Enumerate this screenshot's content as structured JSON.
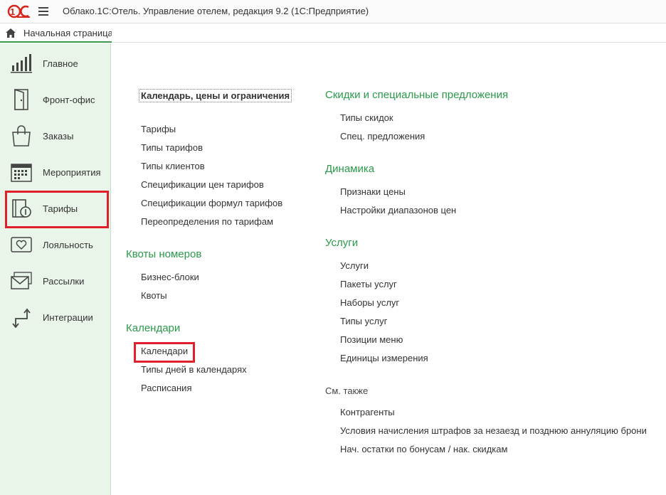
{
  "titlebar": {
    "logo_text": "1С",
    "app_title": "Облако.1С:Отель. Управление отелем, редакция 9.2  (1С:Предприятие)"
  },
  "tabs": {
    "home_label": "Начальная страница"
  },
  "sidebar": {
    "items": [
      {
        "label": "Главное",
        "icon": "bar-chart-icon"
      },
      {
        "label": "Фронт-офис",
        "icon": "door-icon"
      },
      {
        "label": "Заказы",
        "icon": "shopping-bag-icon"
      },
      {
        "label": "Мероприятия",
        "icon": "calendar-icon"
      },
      {
        "label": "Тарифы",
        "icon": "tariff-book-icon"
      },
      {
        "label": "Лояльность",
        "icon": "heart-card-icon"
      },
      {
        "label": "Рассылки",
        "icon": "envelope-icon"
      },
      {
        "label": "Интеграции",
        "icon": "arrows-icon"
      }
    ],
    "active_index": 4
  },
  "main": {
    "left": {
      "section1_head": "Календарь, цены и ограничения",
      "section1_links": [
        "Тарифы",
        "Типы тарифов",
        "Типы клиентов",
        "Спецификации цен тарифов",
        "Спецификации формул тарифов",
        "Переопределения по тарифам"
      ],
      "section2_head": "Квоты номеров",
      "section2_links": [
        "Бизнес-блоки",
        "Квоты"
      ],
      "section3_head": "Календари",
      "section3_links": [
        "Календари",
        "Типы дней в календарях",
        "Расписания"
      ]
    },
    "right": {
      "section1_head": "Скидки и специальные предложения",
      "section1_links": [
        "Типы скидок",
        "Спец. предложения"
      ],
      "section2_head": "Динамика",
      "section2_links": [
        "Признаки цены",
        "Настройки диапазонов цен"
      ],
      "section3_head": "Услуги",
      "section3_links": [
        "Услуги",
        "Пакеты услуг",
        "Наборы услуг",
        "Типы услуг",
        "Позиции меню",
        "Единицы измерения"
      ],
      "see_also_head": "См. также",
      "see_also_links": [
        "Контрагенты",
        "Условия начисления штрафов за незаезд и позднюю аннуляцию брони",
        "Нач. остатки по бонусам / нак. скидкам"
      ]
    }
  },
  "colors": {
    "accent_green": "#2a9a4a",
    "highlight_red": "#e0202a",
    "sidebar_bg": "#eaf5ea"
  }
}
